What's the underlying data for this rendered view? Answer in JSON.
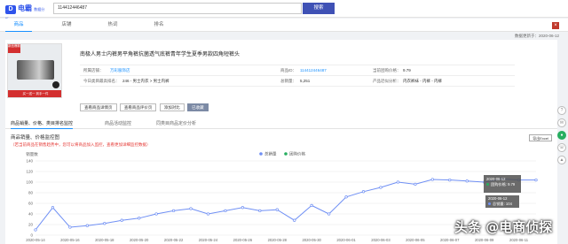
{
  "header": {
    "logo_mark": "D",
    "logo_text": "电霸",
    "logo_sub": "数据分析",
    "search_value": "114412446487",
    "search_button": "搜索"
  },
  "nav": {
    "tabs": [
      {
        "label": "商品"
      },
      {
        "label": "店铺"
      },
      {
        "label": "热词"
      },
      {
        "label": "排名"
      }
    ],
    "close": "×"
  },
  "update_info": "数据更新于：2020-06-12",
  "product": {
    "image_hot": "新品爆款",
    "image_promo": "买一送一 到手一件",
    "title": "南极人男士内裤男平角裤抗菌透气底裤青年学生夏季男款四角短裤头",
    "rows": [
      [
        {
          "label": "所属店铺：",
          "value": "万彩服饰店",
          "link": true
        },
        {
          "label": "商品ID：",
          "value": "114412446487",
          "link": true
        },
        {
          "label": "当前团购价格：",
          "value": "9.79"
        }
      ],
      [
        {
          "label": "今日类目最高排名：",
          "value": "246 - 男士内衣 > 男士内裤"
        },
        {
          "label": "总销量：",
          "value": "5,251"
        },
        {
          "label": "产品近似分析：",
          "value": "内衣裤袜 - 内裤 - 内裤"
        }
      ]
    ],
    "actions": [
      {
        "label": "查看商品详情页"
      },
      {
        "label": "查看商品评价页"
      },
      {
        "label": "添加对比"
      },
      {
        "label": "已收藏",
        "primary": true
      }
    ]
  },
  "subtabs": [
    {
      "label": "商品销量、价格、类目排名监控",
      "active": true
    },
    {
      "label": "商品活动监控"
    },
    {
      "label": "同类目商品定价分析"
    }
  ],
  "section": {
    "title": "商品销量、价格监控图",
    "note": "（若当前商品在销售趋势中，您可以将商品加入监控，查看更加详细监控数据）",
    "export": "导出Excel"
  },
  "chart_data": {
    "type": "line",
    "ylabel": "销量数",
    "yticks": [
      0,
      20,
      40,
      60,
      80,
      100,
      120,
      140
    ],
    "ylim": [
      0,
      140
    ],
    "legend": [
      {
        "name": "总销量",
        "color": "#6f8ff4"
      },
      {
        "name": "团购价格",
        "color": "#27ae60"
      }
    ],
    "legend_position": "top-center",
    "x": [
      "2020-05-14",
      "2020-05-15",
      "2020-05-16",
      "2020-05-17",
      "2020-05-18",
      "2020-05-19",
      "2020-05-20",
      "2020-05-21",
      "2020-05-22",
      "2020-05-23",
      "2020-05-24",
      "2020-05-25",
      "2020-05-26",
      "2020-05-27",
      "2020-05-28",
      "2020-05-29",
      "2020-05-30",
      "2020-05-31",
      "2020-06-01",
      "2020-06-02",
      "2020-06-03",
      "2020-06-04",
      "2020-06-05",
      "2020-06-06",
      "2020-06-07",
      "2020-06-08",
      "2020-06-09",
      "2020-06-10",
      "2020-06-11",
      "2020-06-12"
    ],
    "xtick_labels": [
      "2020-05-14",
      "2020-05-16",
      "2020-05-18",
      "2020-05-20",
      "2020-05-22",
      "2020-05-24",
      "2020-05-26",
      "2020-05-28",
      "2020-05-30",
      "2020-06-01",
      "2020-06-03",
      "2020-06-05",
      "2020-06-07",
      "2020-06-09",
      "2020-06-11"
    ],
    "series": [
      {
        "name": "总销量",
        "color": "#6f8ff4",
        "values": [
          10,
          52,
          15,
          18,
          22,
          28,
          32,
          40,
          46,
          50,
          40,
          46,
          52,
          46,
          48,
          28,
          56,
          40,
          72,
          82,
          90,
          100,
          96,
          105,
          104,
          102,
          100,
          106,
          104,
          104
        ]
      }
    ],
    "grid": true
  },
  "tooltip": {
    "date": "2020-06-12",
    "price_label": "团购价格",
    "price_value": "9.79",
    "date2": "2020-06-12",
    "sales_label": "总销量",
    "sales_value": "104"
  },
  "watermark": "头条 @电商侦探",
  "colors": {
    "accent": "#1890ff",
    "button": "#3f51b5",
    "alert": "#e53935"
  }
}
